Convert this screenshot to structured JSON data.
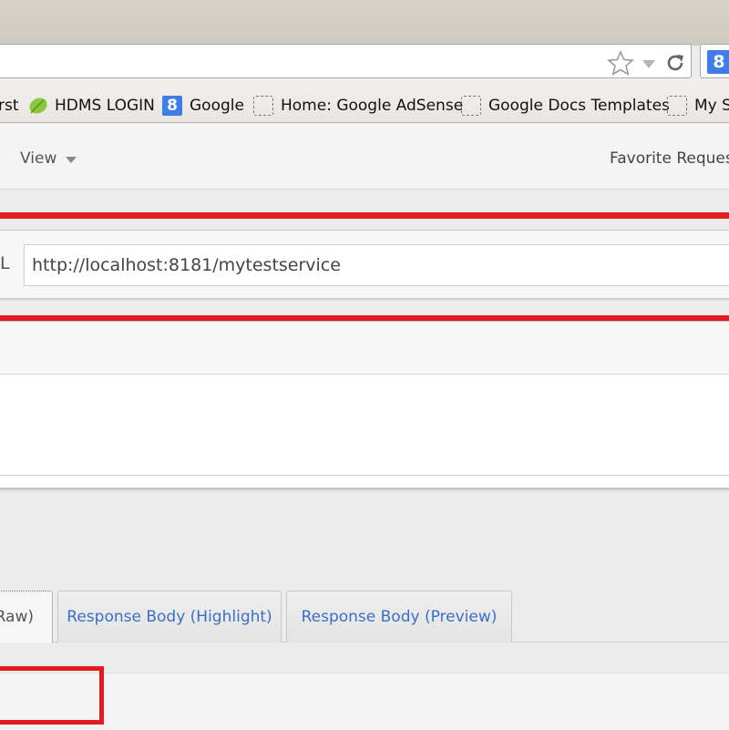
{
  "bookmarks": [
    {
      "label": "rst",
      "icon": "none"
    },
    {
      "label": "HDMS LOGIN",
      "icon": "leaf-icon"
    },
    {
      "label": "Google",
      "icon": "google-icon"
    },
    {
      "label": "Home: Google AdSense",
      "icon": "page-icon"
    },
    {
      "label": "Google Docs Templates",
      "icon": "page-icon"
    },
    {
      "label": "My S",
      "icon": "page-icon"
    }
  ],
  "toolbar": {
    "view_label": "View",
    "favorite_requests_label": "Favorite Request"
  },
  "request": {
    "url_label": "L",
    "url_value": "http://localhost:8181/mytestservice"
  },
  "response": {
    "tabs": [
      {
        "label": "Raw)",
        "selected": true
      },
      {
        "label": "Response Body (Highlight)",
        "selected": false
      },
      {
        "label": "Response Body (Preview)",
        "selected": false
      }
    ]
  },
  "colors": {
    "highlight_red": "#e31b20",
    "tab_link_blue": "#3a6fc8"
  }
}
